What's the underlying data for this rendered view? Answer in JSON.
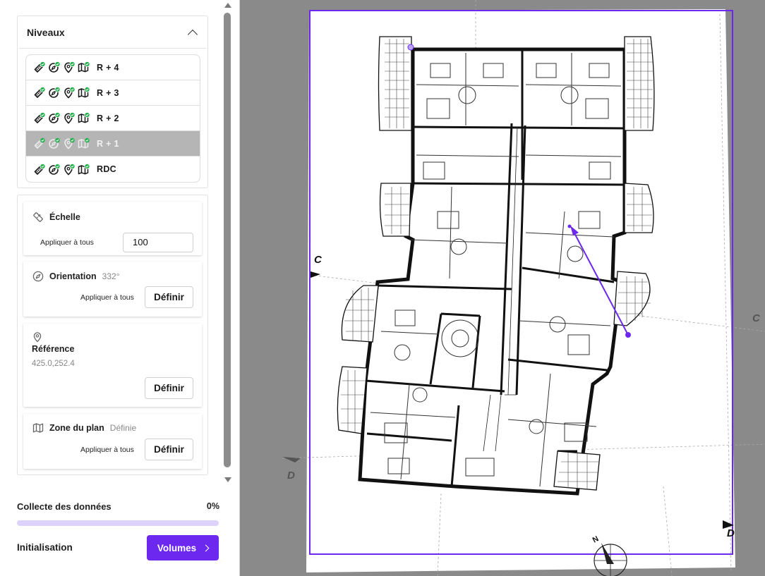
{
  "levels_panel": {
    "title": "Niveaux",
    "items": [
      {
        "label": "R + 4",
        "selected": false
      },
      {
        "label": "R + 3",
        "selected": false
      },
      {
        "label": "R + 2",
        "selected": false
      },
      {
        "label": "R + 1",
        "selected": true
      },
      {
        "label": "RDC",
        "selected": false
      }
    ],
    "status_icons": [
      "ruler-check-icon",
      "compass-check-icon",
      "pin-check-icon",
      "map-check-icon"
    ]
  },
  "scale": {
    "title": "Échelle",
    "apply_all_label": "Appliquer à tous",
    "value": "100"
  },
  "orientation": {
    "title": "Orientation",
    "value": "332°",
    "apply_all_label": "Appliquer à tous",
    "define_label": "Définir"
  },
  "reference": {
    "title": "Référence",
    "value": "425.0,252.4",
    "define_label": "Définir"
  },
  "plan_zone": {
    "title": "Zone du plan",
    "status": "Définie",
    "apply_all_label": "Appliquer à tous",
    "define_label": "Définir"
  },
  "data_collection": {
    "label": "Collecte des données",
    "percent_text": "0%",
    "progress": 0
  },
  "footer": {
    "step_label": "Initialisation",
    "next_button": "Volumes"
  },
  "plan": {
    "section_labels": [
      "C",
      "C",
      "D",
      "D"
    ],
    "compass_label": "N",
    "accent_color": "#6d28f0",
    "check_color": "#22b14c"
  }
}
